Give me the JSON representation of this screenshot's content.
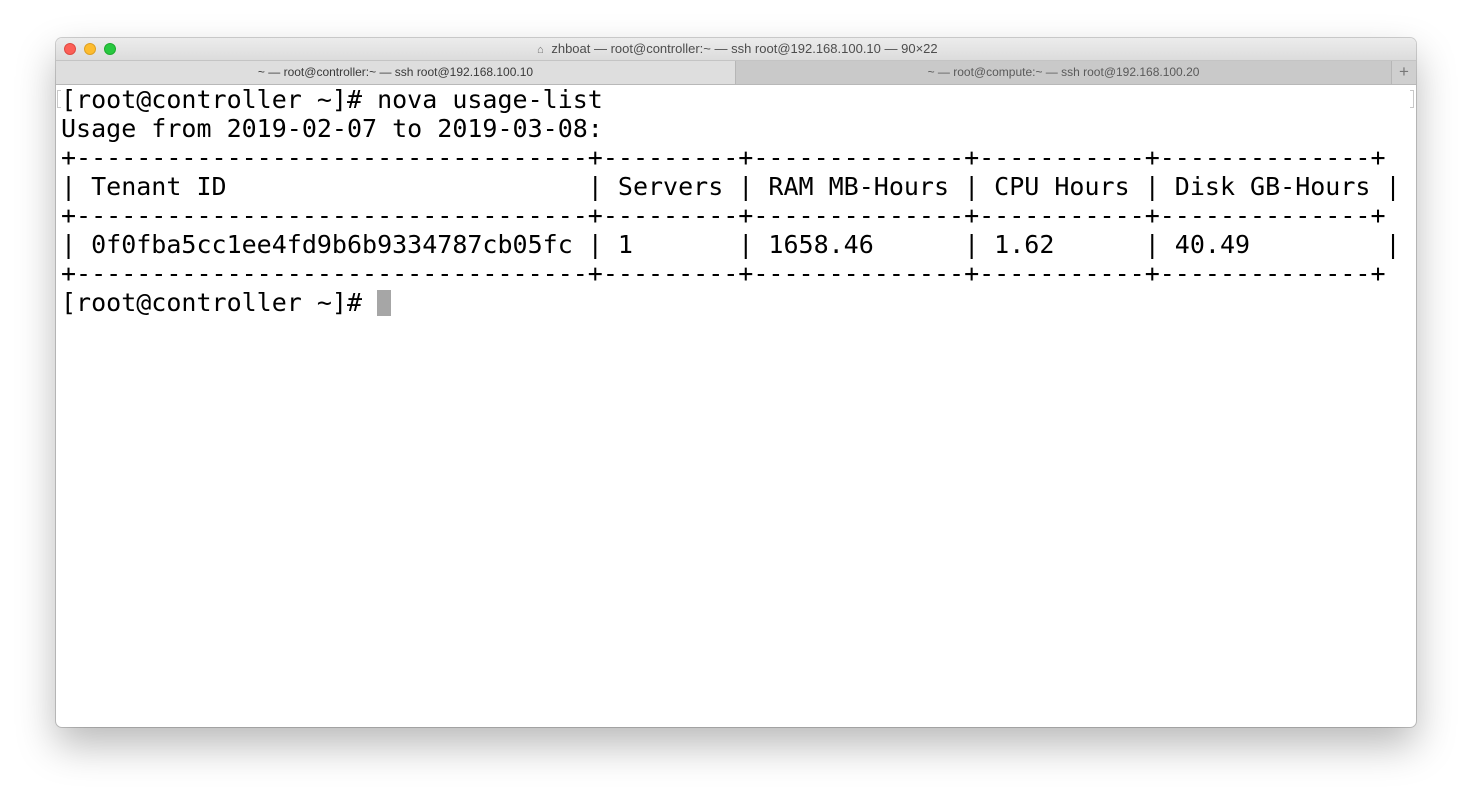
{
  "window": {
    "title": "zhboat — root@controller:~ — ssh root@192.168.100.10 — 90×22",
    "title_icon": "home-icon"
  },
  "tabs": [
    {
      "label": "~ — root@controller:~ — ssh root@192.168.100.10",
      "active": true
    },
    {
      "label": "~ — root@compute:~ — ssh root@192.168.100.20",
      "active": false
    }
  ],
  "new_tab_label": "+",
  "terminal": {
    "lines": [
      "[root@controller ~]# nova usage-list",
      "Usage from 2019-02-07 to 2019-03-08:",
      "+----------------------------------+---------+--------------+-----------+--------------+",
      "| Tenant ID                        | Servers | RAM MB-Hours | CPU Hours | Disk GB-Hours |",
      "+----------------------------------+---------+--------------+-----------+--------------+",
      "| 0f0fba5cc1ee4fd9b6b9334787cb05fc | 1       | 1658.46      | 1.62      | 40.49         |",
      "+----------------------------------+---------+--------------+-----------+--------------+"
    ],
    "prompt": "[root@controller ~]# "
  },
  "colors": {
    "close": "#fc5f57",
    "minimize": "#fdbc2e",
    "maximize": "#28c840",
    "cursor": "#a6a6a6"
  }
}
